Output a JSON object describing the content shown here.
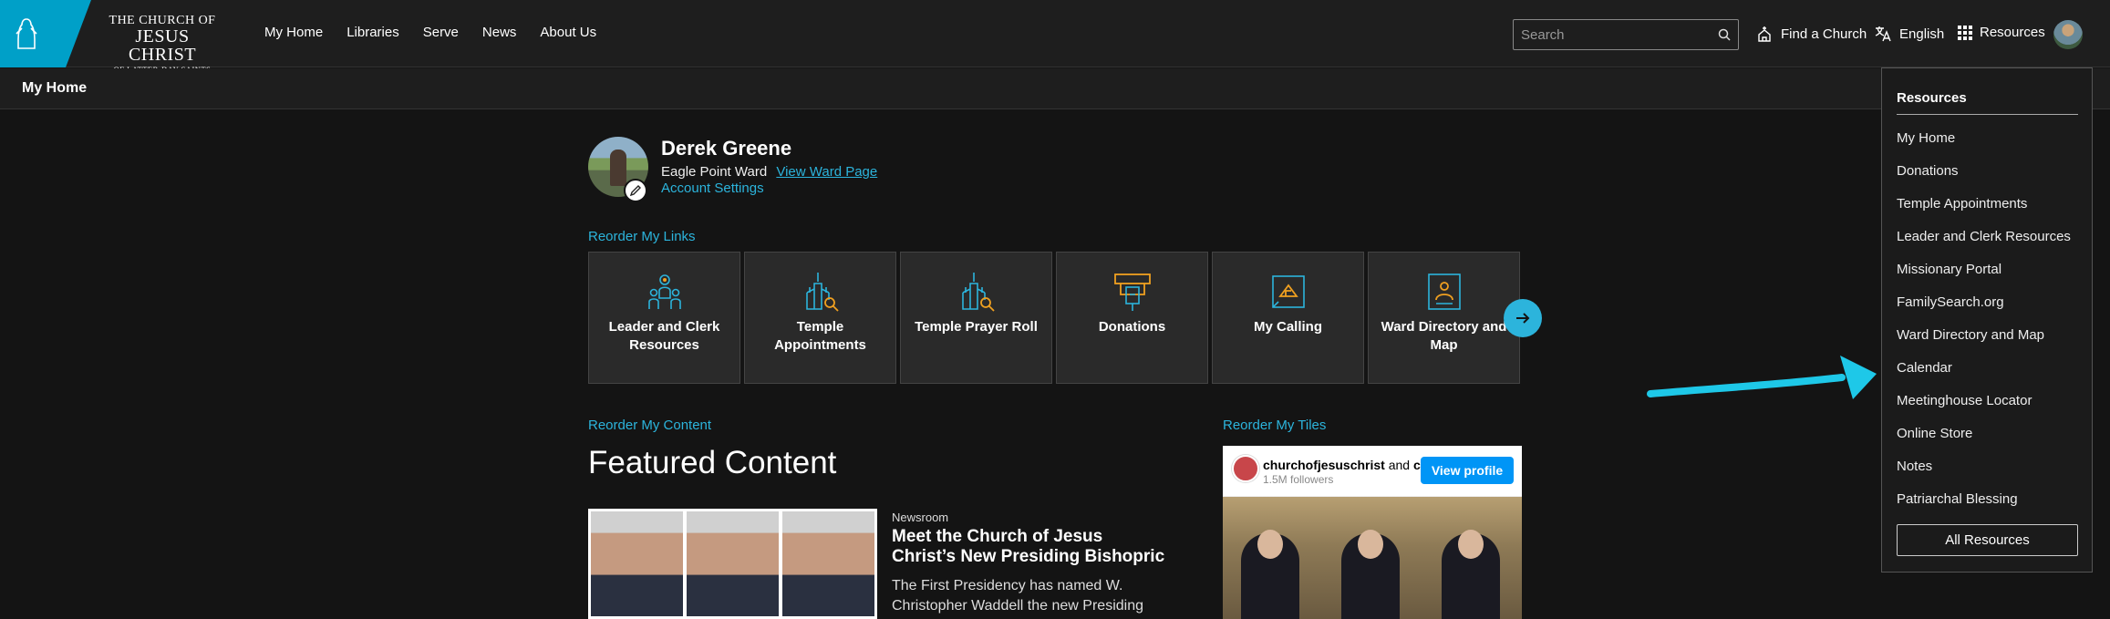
{
  "brand": {
    "line1": "THE CHURCH OF",
    "line2": "JESUS CHRIST",
    "line3": "OF LATTER-DAY SAINTS"
  },
  "nav": {
    "items": [
      "My Home",
      "Libraries",
      "Serve",
      "News",
      "About Us"
    ]
  },
  "search": {
    "placeholder": "Search"
  },
  "top_actions": {
    "find_church": "Find a Church",
    "language": "English",
    "resources": "Resources"
  },
  "subbar": {
    "title": "My Home"
  },
  "profile": {
    "name": "Derek Greene",
    "ward": "Eagle Point Ward",
    "ward_link": "View Ward Page",
    "account_settings": "Account Settings"
  },
  "links": {
    "reorder_label": "Reorder My Links",
    "cards": [
      {
        "label": "Leader and Clerk Resources",
        "icon": "leader-icon"
      },
      {
        "label": "Temple Appointments",
        "icon": "temple-search-icon"
      },
      {
        "label": "Temple Prayer Roll",
        "icon": "temple-search-icon"
      },
      {
        "label": "Donations",
        "icon": "donation-icon"
      },
      {
        "label": "My Calling",
        "icon": "calling-icon"
      },
      {
        "label": "Ward Directory and Map",
        "icon": "directory-icon"
      }
    ]
  },
  "content": {
    "reorder_label": "Reorder My Content",
    "heading": "Featured Content",
    "article": {
      "category": "Newsroom",
      "title": "Meet the Church of Jesus Christ’s New Presiding Bishopric",
      "description": "The First Presidency has named W. Christopher Waddell the new Presiding"
    }
  },
  "tiles": {
    "reorder_label": "Reorder My Tiles",
    "instagram": {
      "account": "churchofjesuschrist",
      "and": "and",
      "extra": "c",
      "followers": "1.5M followers",
      "button": "View profile"
    }
  },
  "resources_menu": {
    "heading": "Resources",
    "items": [
      "My Home",
      "Donations",
      "Temple Appointments",
      "Leader and Clerk Resources",
      "Missionary Portal",
      "FamilySearch.org",
      "Ward Directory and Map",
      "Calendar",
      "Meetinghouse Locator",
      "Online Store",
      "Notes",
      "Patriarchal Blessing"
    ],
    "all_button": "All Resources"
  },
  "colors": {
    "accent": "#2cb4dc",
    "logo": "#00a0c8",
    "annotation_arrow": "#1ec8e8",
    "icon_orange": "#f0a020"
  }
}
